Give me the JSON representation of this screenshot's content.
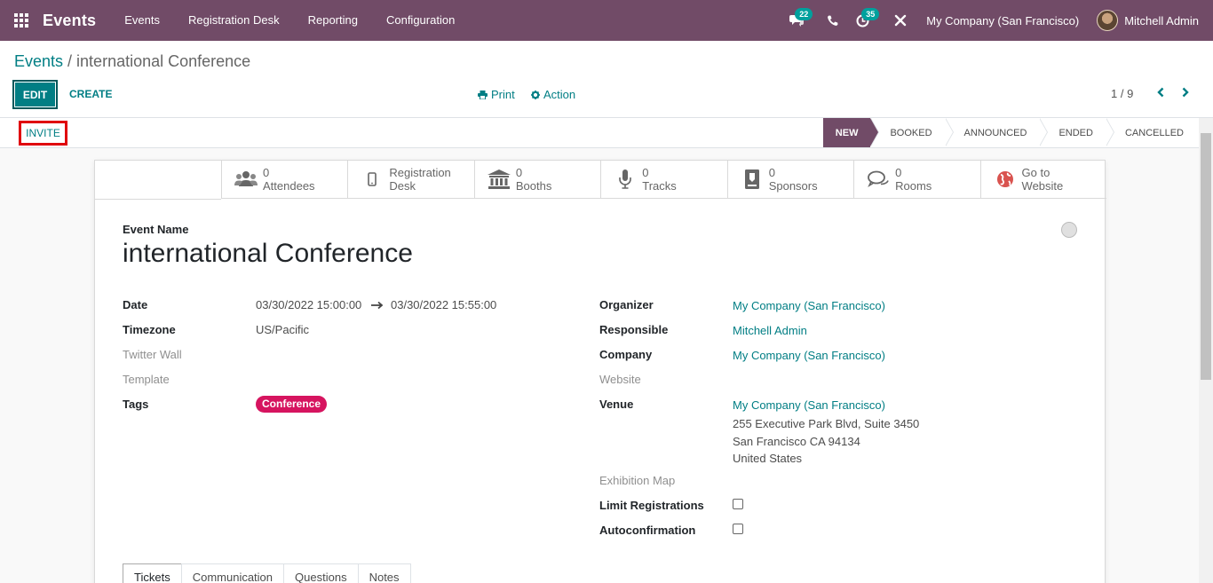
{
  "nav": {
    "app_name": "Events",
    "menu": [
      "Events",
      "Registration Desk",
      "Reporting",
      "Configuration"
    ],
    "messages_count": "22",
    "activities_count": "35",
    "company": "My Company (San Francisco)",
    "user": "Mitchell Admin"
  },
  "breadcrumb": {
    "parent": "Events",
    "separator": " / ",
    "current": "international Conference"
  },
  "toolbar": {
    "edit_label": "EDIT",
    "create_label": "CREATE",
    "print_label": "Print",
    "action_label": "Action",
    "pager": "1 / 9"
  },
  "statusbar": {
    "invite_label": "INVITE",
    "stages": [
      "NEW",
      "BOOKED",
      "ANNOUNCED",
      "ENDED",
      "CANCELLED"
    ],
    "active_stage": "NEW"
  },
  "stat_buttons": [
    {
      "value": "0",
      "label": "Attendees",
      "icon": "users-icon"
    },
    {
      "value": "Registration",
      "label": "Desk",
      "icon": "mobile-icon"
    },
    {
      "value": "0",
      "label": "Booths",
      "icon": "bank-icon"
    },
    {
      "value": "0",
      "label": "Tracks",
      "icon": "microphone-icon"
    },
    {
      "value": "0",
      "label": "Sponsors",
      "icon": "badge-icon"
    },
    {
      "value": "0",
      "label": "Rooms",
      "icon": "comments-icon"
    },
    {
      "value": "Go to",
      "label": "Website",
      "icon": "globe-icon"
    }
  ],
  "form": {
    "name_label": "Event Name",
    "name": "international Conference",
    "left": {
      "date_label": "Date",
      "date_begin": "03/30/2022 15:00:00",
      "date_end": "03/30/2022 15:55:00",
      "timezone_label": "Timezone",
      "timezone": "US/Pacific",
      "twitter_label": "Twitter Wall",
      "template_label": "Template",
      "tags_label": "Tags",
      "tag": "Conference"
    },
    "right": {
      "organizer_label": "Organizer",
      "organizer": "My Company (San Francisco)",
      "responsible_label": "Responsible",
      "responsible": "Mitchell Admin",
      "company_label": "Company",
      "company": "My Company (San Francisco)",
      "website_label": "Website",
      "venue_label": "Venue",
      "venue_name": "My Company (San Francisco)",
      "venue_street": "255 Executive Park Blvd, Suite 3450",
      "venue_city": "San Francisco CA 94134",
      "venue_country": "United States",
      "exhibition_label": "Exhibition Map",
      "limit_label": "Limit Registrations",
      "autoconfirm_label": "Autoconfirmation"
    }
  },
  "tabs": [
    "Tickets",
    "Communication",
    "Questions",
    "Notes"
  ],
  "colors": {
    "brand": "#714B67",
    "accent": "#017e84",
    "tag": "#d6145f",
    "highlight": "#e0000d"
  }
}
